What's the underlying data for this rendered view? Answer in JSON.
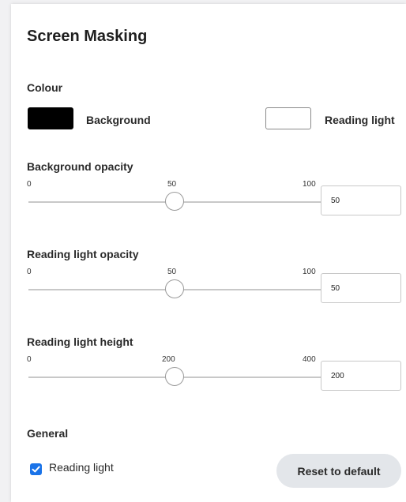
{
  "title": "Screen Masking",
  "colour": {
    "heading": "Colour",
    "background_label": "Background",
    "background_color": "#000000",
    "reading_light_label": "Reading light",
    "reading_light_color": "#ffffff"
  },
  "sliders": [
    {
      "label": "Background opacity",
      "min": "0",
      "mid": "50",
      "max": "100",
      "value": "50",
      "fraction": 0.5
    },
    {
      "label": "Reading light opacity",
      "min": "0",
      "mid": "50",
      "max": "100",
      "value": "50",
      "fraction": 0.5
    },
    {
      "label": "Reading light height",
      "min": "0",
      "mid": "200",
      "max": "400",
      "value": "200",
      "fraction": 0.5
    }
  ],
  "general": {
    "heading": "General",
    "checkbox_label": "Reading light",
    "checkbox_checked": true,
    "reset_label": "Reset to default"
  }
}
